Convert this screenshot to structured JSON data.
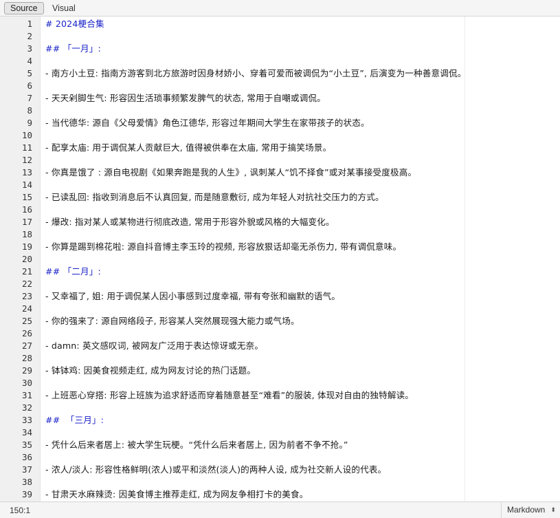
{
  "toolbar": {
    "source_label": "Source",
    "visual_label": "Visual"
  },
  "editor": {
    "lines": [
      {
        "n": "1",
        "text": "# 2024梗合集",
        "type": "header"
      },
      {
        "n": "2",
        "text": "",
        "type": "text"
      },
      {
        "n": "3",
        "text": "## 「一月」:",
        "type": "header"
      },
      {
        "n": "4",
        "text": "",
        "type": "text"
      },
      {
        "n": "5",
        "text": "- 南方小土豆: 指南方游客到北方旅游时因身材娇小、穿着可爱而被调侃为“小土豆”, 后演变为一种善意调侃。",
        "type": "text"
      },
      {
        "n": "6",
        "text": "",
        "type": "text"
      },
      {
        "n": "7",
        "text": "- 天天剁脚生气: 形容因生活琐事频繁发脾气的状态, 常用于自嘲或调侃。",
        "type": "text"
      },
      {
        "n": "8",
        "text": "",
        "type": "text"
      },
      {
        "n": "9",
        "text": "- 当代德华: 源自《父母爱情》角色江德华, 形容过年期间大学生在家带孩子的状态。",
        "type": "text"
      },
      {
        "n": "10",
        "text": "",
        "type": "text"
      },
      {
        "n": "11",
        "text": "- 配享太庙: 用于调侃某人贡献巨大, 值得被供奉在太庙, 常用于搞笑场景。",
        "type": "text"
      },
      {
        "n": "12",
        "text": "",
        "type": "text"
      },
      {
        "n": "13",
        "text": "- 你真是饿了 : 源自电视剧《如果奔跑是我的人生》, 讽刺某人“饥不择食”或对某事接受度极高。",
        "type": "text"
      },
      {
        "n": "14",
        "text": "",
        "type": "text"
      },
      {
        "n": "15",
        "text": "- 已读乱回: 指收到消息后不认真回复, 而是随意敷衍, 成为年轻人对抗社交压力的方式。",
        "type": "text"
      },
      {
        "n": "16",
        "text": "",
        "type": "text"
      },
      {
        "n": "17",
        "text": "- 爆改: 指对某人或某物进行彻底改造, 常用于形容外貌或风格的大幅变化。",
        "type": "text"
      },
      {
        "n": "18",
        "text": "",
        "type": "text"
      },
      {
        "n": "19",
        "text": "- 你算是踢到棉花啦: 源自抖音博主李玉玲的视频, 形容放狠话却毫无杀伤力, 带有调侃意味。",
        "type": "text"
      },
      {
        "n": "20",
        "text": "",
        "type": "text"
      },
      {
        "n": "21",
        "text": "## 「二月」:",
        "type": "header"
      },
      {
        "n": "22",
        "text": "",
        "type": "text"
      },
      {
        "n": "23",
        "text": "- 又幸福了, 姐: 用于调侃某人因小事感到过度幸福, 带有夸张和幽默的语气。",
        "type": "text"
      },
      {
        "n": "24",
        "text": "",
        "type": "text"
      },
      {
        "n": "25",
        "text": "- 你的强来了: 源自网络段子, 形容某人突然展现强大能力或气场。",
        "type": "text"
      },
      {
        "n": "26",
        "text": "",
        "type": "text"
      },
      {
        "n": "27",
        "text": "- damn: 英文感叹词, 被网友广泛用于表达惊讶或无奈。",
        "type": "text"
      },
      {
        "n": "28",
        "text": "",
        "type": "text"
      },
      {
        "n": "29",
        "text": "- 钵钵鸡: 因美食视频走红, 成为网友讨论的热门话题。",
        "type": "text"
      },
      {
        "n": "30",
        "text": "",
        "type": "text"
      },
      {
        "n": "31",
        "text": "- 上班恶心穿搭: 形容上班族为追求舒适而穿着随意甚至“难看”的服装, 体现对自由的独特解读。",
        "type": "text"
      },
      {
        "n": "32",
        "text": "",
        "type": "text"
      },
      {
        "n": "33",
        "text": "##  「三月」:",
        "type": "header"
      },
      {
        "n": "34",
        "text": "",
        "type": "text"
      },
      {
        "n": "35",
        "text": "- 凭什么后来者居上: 被大学生玩梗。“凭什么后来者居上, 因为前者不争不抢。”",
        "type": "text"
      },
      {
        "n": "36",
        "text": "",
        "type": "text"
      },
      {
        "n": "37",
        "text": "- 浓人/淡人: 形容性格鲜明(浓人)或平和淡然(淡人)的两种人设, 成为社交新人设的代表。",
        "type": "text"
      },
      {
        "n": "38",
        "text": "",
        "type": "text"
      },
      {
        "n": "39",
        "text": "- 甘肃天水麻辣烫: 因美食博主推荐走红, 成为网友争相打卡的美食。",
        "type": "text"
      }
    ]
  },
  "statusbar": {
    "cursor_position": "150:1",
    "mode": "Markdown",
    "mode_arrow": "⬍"
  }
}
